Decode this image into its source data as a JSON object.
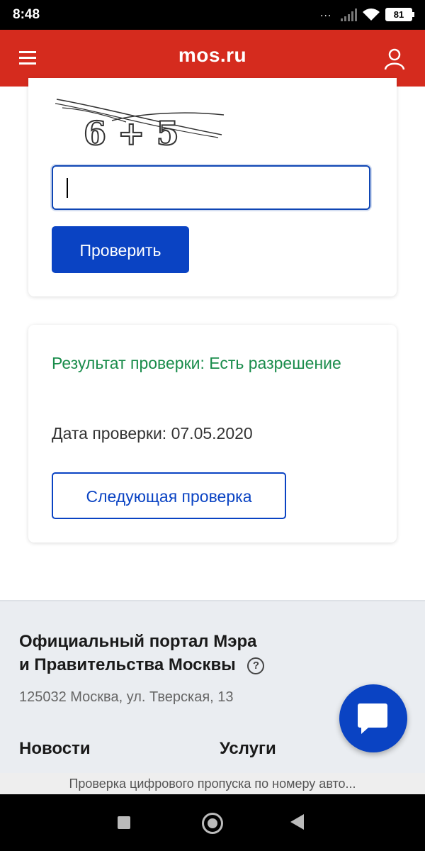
{
  "status_bar": {
    "time": "8:48",
    "battery": "81",
    "dots": "..."
  },
  "header": {
    "logo": "mos.ru"
  },
  "captcha_card": {
    "captcha_text": "6 + 5",
    "input_value": "",
    "check_button": "Проверить"
  },
  "result_card": {
    "result": "Результат проверки: Есть разрешение",
    "date": "Дата проверки: 07.05.2020",
    "next_button": "Следующая проверка"
  },
  "footer": {
    "title_line1": "Официальный портал Мэра",
    "title_line2": "и Правительства Москвы",
    "help": "?",
    "address": "125032 Москва, ул. Тверская, 13",
    "nav_news": "Новости",
    "nav_services": "Услуги"
  },
  "page_title_bar": "Проверка цифрового пропуска по номеру авто...",
  "colors": {
    "brand_red": "#d52b1e",
    "primary_blue": "#0a43c3",
    "success_green": "#198c4b"
  }
}
